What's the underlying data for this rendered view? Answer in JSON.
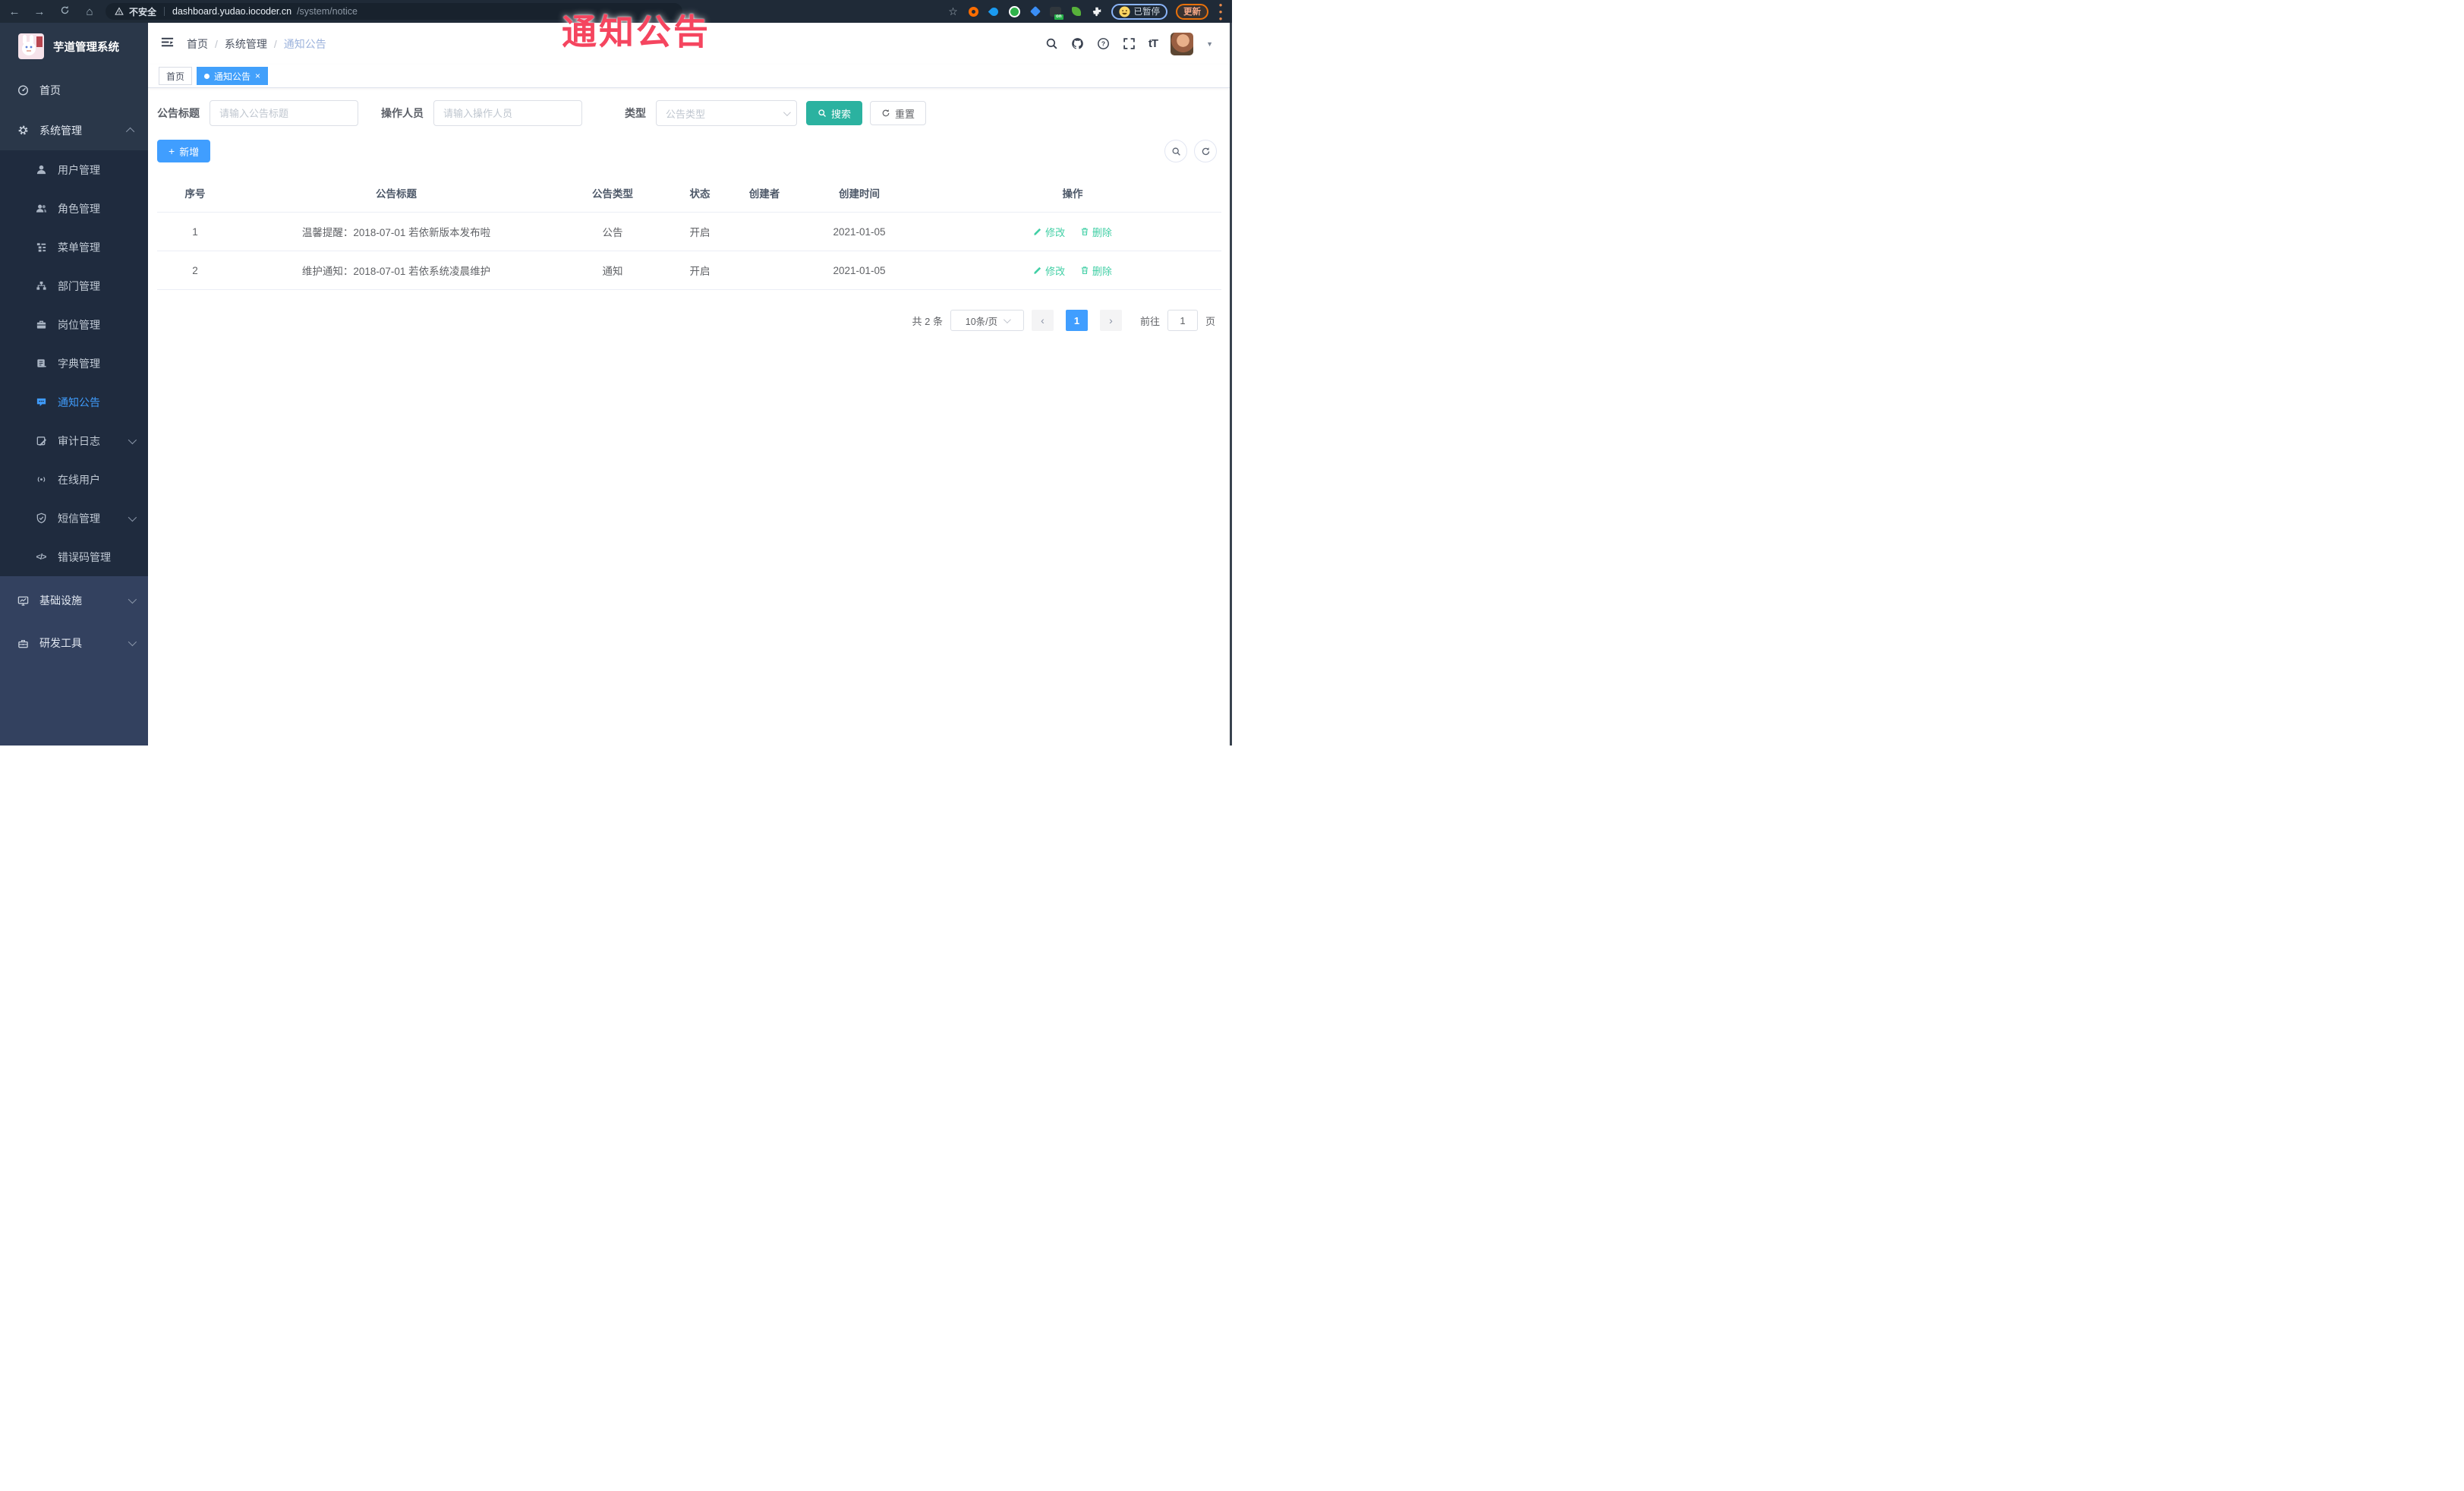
{
  "overlay": {
    "text": "通知公告",
    "color": "#f5455f"
  },
  "browser": {
    "insecure_label": "不安全",
    "url_host": "dashboard.yudao.iocoder.cn",
    "url_path": "/system/notice",
    "profile_status": "已暂停",
    "update_label": "更新"
  },
  "sidebar": {
    "app_title": "芋道管理系统",
    "items": [
      {
        "label": "首页",
        "icon": "dashboard-icon",
        "level": 1
      },
      {
        "label": "系统管理",
        "icon": "gear-icon",
        "level": 1,
        "expanded": true
      },
      {
        "label": "用户管理",
        "icon": "user-icon",
        "level": 2
      },
      {
        "label": "角色管理",
        "icon": "users-icon",
        "level": 2
      },
      {
        "label": "菜单管理",
        "icon": "menu-tree-icon",
        "level": 2
      },
      {
        "label": "部门管理",
        "icon": "org-icon",
        "level": 2
      },
      {
        "label": "岗位管理",
        "icon": "briefcase-icon",
        "level": 2
      },
      {
        "label": "字典管理",
        "icon": "book-icon",
        "level": 2
      },
      {
        "label": "通知公告",
        "icon": "megaphone-icon",
        "level": 2,
        "active": true
      },
      {
        "label": "审计日志",
        "icon": "log-icon",
        "level": 2,
        "collapsed": true
      },
      {
        "label": "在线用户",
        "icon": "online-icon",
        "level": 2
      },
      {
        "label": "短信管理",
        "icon": "sms-icon",
        "level": 2,
        "collapsed": true
      },
      {
        "label": "错误码管理",
        "icon": "code-icon",
        "level": 2
      },
      {
        "label": "基础设施",
        "icon": "monitor-icon",
        "level": 1,
        "collapsed": true
      },
      {
        "label": "研发工具",
        "icon": "toolbox-icon",
        "level": 1,
        "collapsed": true
      }
    ]
  },
  "header": {
    "breadcrumb": [
      "首页",
      "系统管理",
      "通知公告"
    ]
  },
  "tabs": [
    {
      "label": "首页",
      "active": false
    },
    {
      "label": "通知公告",
      "active": true,
      "closable": true
    }
  ],
  "filters": {
    "title_label": "公告标题",
    "title_placeholder": "请输入公告标题",
    "operator_label": "操作人员",
    "operator_placeholder": "请输入操作人员",
    "type_label": "类型",
    "type_placeholder": "公告类型",
    "search_label": "搜索",
    "reset_label": "重置"
  },
  "toolbar": {
    "add_label": "新增"
  },
  "table": {
    "columns": [
      "序号",
      "公告标题",
      "公告类型",
      "状态",
      "创建者",
      "创建时间",
      "操作"
    ],
    "rows": [
      {
        "no": "1",
        "title": "温馨提醒：2018-07-01 若依新版本发布啦",
        "type": "公告",
        "status": "开启",
        "creator": "",
        "created": "2021-01-05"
      },
      {
        "no": "2",
        "title": "维护通知：2018-07-01 若依系统凌晨维护",
        "type": "通知",
        "status": "开启",
        "creator": "",
        "created": "2021-01-05"
      }
    ],
    "edit_label": "修改",
    "delete_label": "删除"
  },
  "pagination": {
    "total": "共 2 条",
    "page_size": "10条/页",
    "current_page": "1",
    "goto_label": "前往",
    "goto_value": "1",
    "page_suffix": "页"
  },
  "colors": {
    "accent_blue": "#409eff",
    "search_teal": "#2bb2a0",
    "action_green": "#41cfa5",
    "sidebar_dark": "#2a3749",
    "submenu_dark": "#1f2b3e",
    "sidebar_light": "#33415f",
    "chrome_dark": "#1f2a37",
    "annotation_red": "#f5455f"
  }
}
